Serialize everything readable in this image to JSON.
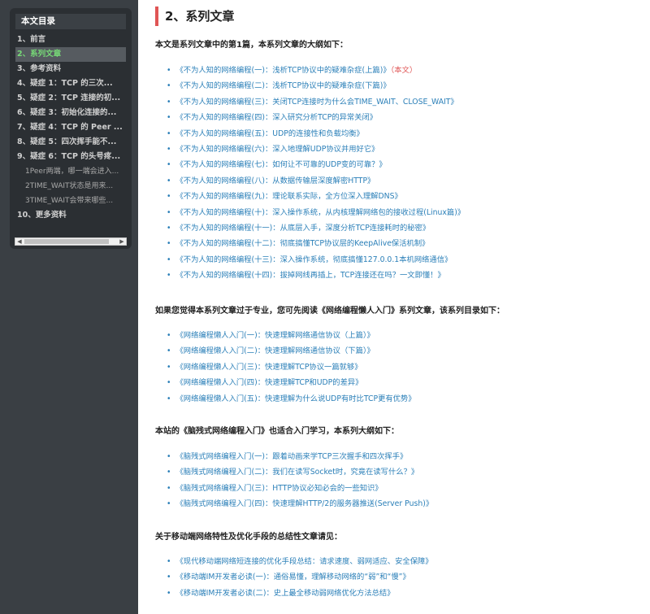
{
  "toc": {
    "title": "本文目录",
    "items": [
      {
        "label": "1、前言",
        "active": false,
        "sub": false
      },
      {
        "label": "2、系列文章",
        "active": true,
        "sub": false
      },
      {
        "label": "3、参考资料",
        "active": false,
        "sub": false
      },
      {
        "label": "4、疑症 1：TCP 的三次...",
        "active": false,
        "sub": false
      },
      {
        "label": "5、疑症 2：TCP 连接的初...",
        "active": false,
        "sub": false
      },
      {
        "label": "6、疑症 3：初始化连接的...",
        "active": false,
        "sub": false
      },
      {
        "label": "7、疑症 4：TCP 的 Peer ...",
        "active": false,
        "sub": false
      },
      {
        "label": "8、疑症 5：四次挥手能不...",
        "active": false,
        "sub": false
      },
      {
        "label": "9、疑症 6：TCP 的头号疼...",
        "active": false,
        "sub": false
      },
      {
        "label": "1Peer两端，哪一端会进入...",
        "active": false,
        "sub": true
      },
      {
        "label": "2TIME_WAIT状态是用来...",
        "active": false,
        "sub": true
      },
      {
        "label": "3TIME_WAIT会带来哪些...",
        "active": false,
        "sub": true
      },
      {
        "label": "10、更多资料",
        "active": false,
        "sub": false
      }
    ]
  },
  "main": {
    "heading": "2、系列文章",
    "sections": [
      {
        "intro": "本文是系列文章中的第1篇，本系列文章的大纲如下：",
        "links": [
          {
            "text": "《不为人知的网络编程(一)：浅析TCP协议中的疑难杂症(上篇)》",
            "tag": "（本文）"
          },
          {
            "text": "《不为人知的网络编程(二)：浅析TCP协议中的疑难杂症(下篇)》"
          },
          {
            "text": "《不为人知的网络编程(三)：关闭TCP连接时为什么会TIME_WAIT、CLOSE_WAIT》"
          },
          {
            "text": "《不为人知的网络编程(四)：深入研究分析TCP的异常关闭》"
          },
          {
            "text": "《不为人知的网络编程(五)：UDP的连接性和负载均衡》"
          },
          {
            "text": "《不为人知的网络编程(六)：深入地理解UDP协议并用好它》"
          },
          {
            "text": "《不为人知的网络编程(七)：如何让不可靠的UDP变的可靠？》"
          },
          {
            "text": "《不为人知的网络编程(八)：从数据传输层深度解密HTTP》"
          },
          {
            "text": "《不为人知的网络编程(九)：理论联系实际，全方位深入理解DNS》"
          },
          {
            "text": "《不为人知的网络编程(十)：深入操作系统，从内核理解网络包的接收过程(Linux篇)》"
          },
          {
            "text": "《不为人知的网络编程(十一)：从底层入手，深度分析TCP连接耗时的秘密》"
          },
          {
            "text": "《不为人知的网络编程(十二)：彻底搞懂TCP协议层的KeepAlive保活机制》"
          },
          {
            "text": "《不为人知的网络编程(十三)：深入操作系统，彻底搞懂127.0.0.1本机网络通信》"
          },
          {
            "text": "《不为人知的网络编程(十四)：拔掉网线再插上，TCP连接还在吗？一文即懂！》"
          }
        ]
      },
      {
        "intro": "如果您觉得本系列文章过于专业，您可先阅读《网络编程懒人入门》系列文章，该系列目录如下：",
        "links": [
          {
            "text": "《网络编程懒人入门(一)：快速理解网络通信协议（上篇）》"
          },
          {
            "text": "《网络编程懒人入门(二)：快速理解网络通信协议（下篇）》"
          },
          {
            "text": "《网络编程懒人入门(三)：快速理解TCP协议一篇就够》"
          },
          {
            "text": "《网络编程懒人入门(四)：快速理解TCP和UDP的差异》"
          },
          {
            "text": "《网络编程懒人入门(五)：快速理解为什么说UDP有时比TCP更有优势》"
          }
        ]
      },
      {
        "intro": "本站的《脑残式网络编程入门》也适合入门学习，本系列大纲如下：",
        "links": [
          {
            "text": "《脑残式网络编程入门(一)：跟着动画来学TCP三次握手和四次挥手》"
          },
          {
            "text": "《脑残式网络编程入门(二)：我们在读写Socket时，究竟在读写什么？》"
          },
          {
            "text": "《脑残式网络编程入门(三)：HTTP协议必知必会的一些知识》"
          },
          {
            "text": "《脑残式网络编程入门(四)：快速理解HTTP/2的服务器推送(Server Push)》"
          }
        ]
      },
      {
        "intro": "关于移动端网络特性及优化手段的总结性文章请见：",
        "links": [
          {
            "text": "《现代移动端网络短连接的优化手段总结：请求速度、弱网适应、安全保障》"
          },
          {
            "text": "《移动端IM开发者必读(一)：通俗易懂，理解移动网络的“弱”和“慢”》"
          },
          {
            "text": "《移动端IM开发者必读(二)：史上最全移动弱网络优化方法总结》"
          }
        ]
      }
    ]
  },
  "colors": {
    "link": "#2a7fb8",
    "accent": "#e05555",
    "toc_active": "#77d977"
  }
}
